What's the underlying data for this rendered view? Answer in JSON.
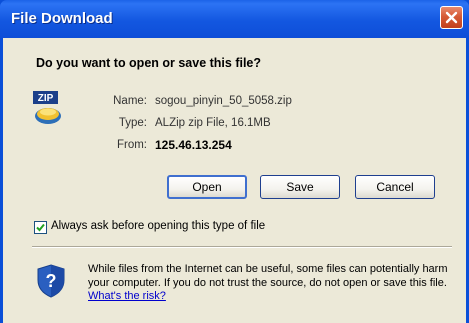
{
  "window": {
    "title": "File Download",
    "close_icon": "close-icon"
  },
  "dialog": {
    "question": "Do you want to open or save this file?",
    "file_icon": "zip-file-icon",
    "file_icon_text": "ZIP",
    "fields": [
      {
        "label": "Name:",
        "value": "sogou_pinyin_50_5058.zip"
      },
      {
        "label": "Type:",
        "value": "ALZip zip File, 16.1MB"
      },
      {
        "label": "From:",
        "value": "125.46.13.254"
      }
    ],
    "buttons": {
      "open": "Open",
      "save": "Save",
      "cancel": "Cancel"
    },
    "checkbox": {
      "label": "Always ask before opening this type of file",
      "checked": true
    },
    "warning": {
      "icon": "shield-question-icon",
      "text": "While files from the Internet can be useful, some files can potentially harm your computer. If you do not trust the source, do not open or save this file.",
      "link": "What's the risk?"
    }
  },
  "colors": {
    "titlebar": "#0e4ed8",
    "client_bg": "#ece9d8",
    "close_button": "#d65a35",
    "link": "#0000cc"
  }
}
